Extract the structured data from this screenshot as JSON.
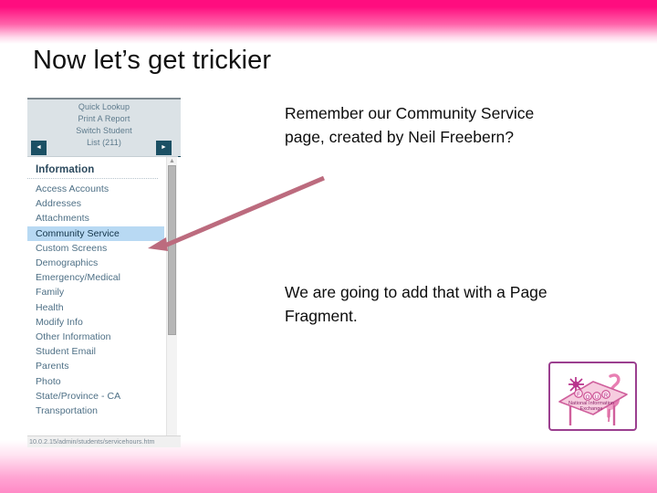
{
  "slide": {
    "title": "Now let’s get trickier"
  },
  "colors": {
    "band_top_start": "#ff0d7f",
    "band_bottom_end": "#ff8ac6",
    "arrow": "#bc6b7e",
    "selected_row": "#b8d9f3",
    "app_header_bg": "#dbe2e6",
    "nav_button": "#1b5064",
    "logo_border": "#9b3f8f"
  },
  "text_blocks": [
    {
      "id": "text-block-1",
      "text": "Remember our Community Service page, created by Neil Freebern?"
    },
    {
      "id": "text-block-2",
      "text": "We are going to add that with a Page Fragment."
    }
  ],
  "screenshot": {
    "header": {
      "links": [
        "Quick Lookup",
        "Print A Report",
        "Switch Student",
        "List (211)"
      ],
      "prev_button": "◄",
      "next_button": "►"
    },
    "menu": {
      "title": "Information",
      "items": [
        "Access Accounts",
        "Addresses",
        "Attachments",
        "Community Service",
        "Custom Screens",
        "Demographics",
        "Emergency/Medical",
        "Family",
        "Health",
        "Modify Info",
        "Other Information",
        "Student Email",
        "Parents",
        "Photo",
        "State/Province - CA",
        "Transportation"
      ],
      "selected": "Community Service"
    },
    "scrollbar": {
      "up_arrow": "▲"
    },
    "status_bar": {
      "url": "10.0.2.15/admin/students/servicehours.htm"
    }
  },
  "logo": {
    "sign_letters": [
      "F",
      "O",
      "U",
      "R"
    ],
    "line1": "National Information",
    "line2": "Exchange"
  }
}
